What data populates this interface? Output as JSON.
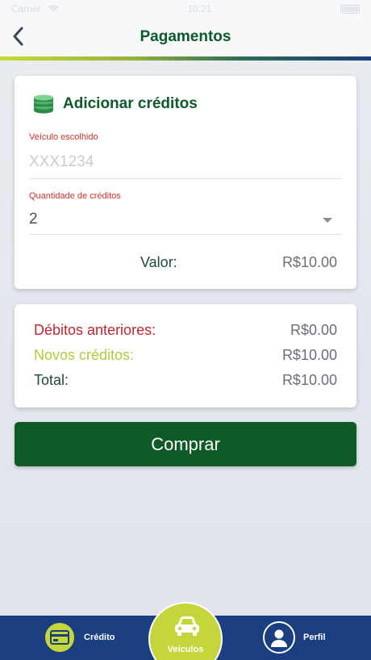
{
  "statusbar": {
    "carrier": "Carrier",
    "wifi": "wifi-icon",
    "time": "10:21"
  },
  "header": {
    "title": "Pagamentos",
    "back_icon": "chevron-left-icon"
  },
  "add_credits": {
    "title": "Adicionar créditos",
    "icon": "coins-stack-icon",
    "vehicle_label": "Veículo escolhido",
    "vehicle_placeholder": "XXX1234",
    "quantity_label": "Quantidade de créditos",
    "quantity_value": "2",
    "value_label": "Valor:",
    "value_amount": "R$10.00"
  },
  "summary": {
    "previous_debts_label": "Débitos anteriores:",
    "previous_debts_value": "R$0.00",
    "new_credits_label": "Novos créditos:",
    "new_credits_value": "R$10.00",
    "total_label": "Total:",
    "total_value": "R$10.00"
  },
  "buy_button": "Comprar",
  "tabs": {
    "credit": "Crédito",
    "vehicles": "Veículos",
    "profile": "Perfil"
  },
  "colors": {
    "brand_green": "#0c5a2a",
    "lime": "#c5d63a",
    "navy": "#1a3e80",
    "debt_red": "#c1272d"
  }
}
